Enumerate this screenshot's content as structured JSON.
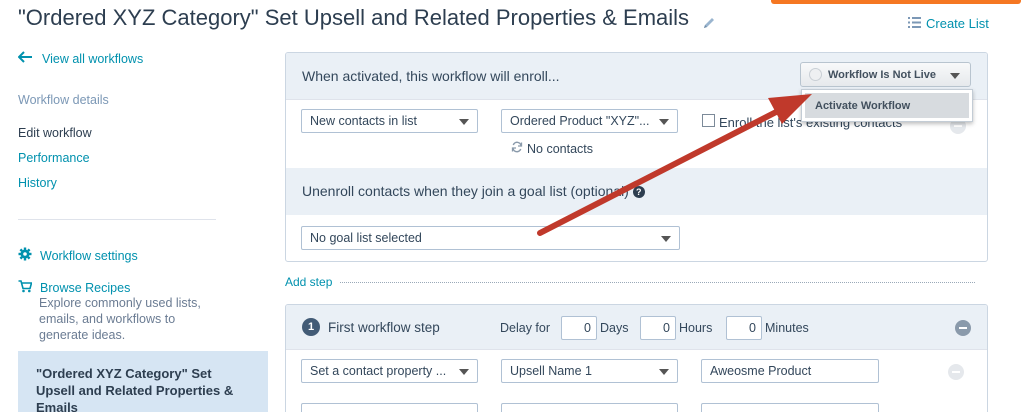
{
  "header": {
    "title": "\"Ordered XYZ Category\" Set Upsell and Related Properties & Emails",
    "create_list": "Create List"
  },
  "sidebar": {
    "view_all": "View all workflows",
    "details_heading": "Workflow details",
    "items": [
      {
        "label": "Edit workflow"
      },
      {
        "label": "Performance"
      },
      {
        "label": "History"
      }
    ],
    "settings": "Workflow settings",
    "recipes": "Browse Recipes",
    "recipes_desc": "Explore commonly used lists, emails, and workflows to generate ideas.",
    "current_workflow": "\"Ordered XYZ Category\" Set Upsell and Related Properties & Emails"
  },
  "enroll": {
    "heading": "When activated, this workflow will enroll...",
    "status_button": "Workflow Is Not Live",
    "dropdown_item": "Activate Workflow",
    "criteria_select": "New contacts in list",
    "list_select": "Ordered Product \"XYZ\"...",
    "enroll_existing": "Enroll the list's existing contacts",
    "no_contacts": "No contacts",
    "unenroll_heading": "Unenroll contacts when they join a goal list (optional)",
    "goal_select": "No goal list selected"
  },
  "add_step": "Add step",
  "step": {
    "number": "1",
    "title": "First workflow step",
    "delay_label": "Delay for",
    "days_value": "0",
    "days_label": "Days",
    "hours_value": "0",
    "hours_label": "Hours",
    "minutes_value": "0",
    "minutes_label": "Minutes",
    "action_select": "Set a contact property ...",
    "property_select": "Upsell Name 1",
    "property_value": "Aweosme Product"
  },
  "colors": {
    "accent": "#0091ae",
    "arrow": "#c0392b",
    "orange": "#f57722"
  }
}
